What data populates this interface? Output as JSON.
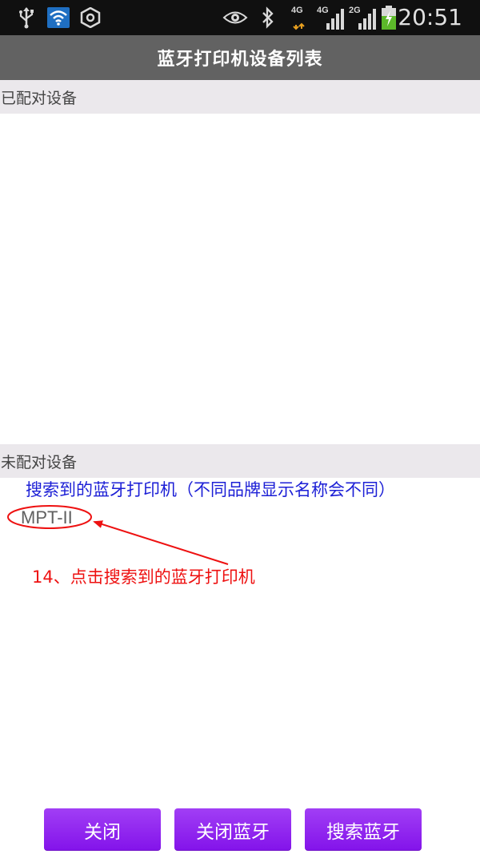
{
  "status_bar": {
    "time": "20:51",
    "icons": [
      "usb-icon",
      "wifi-icon",
      "settings-hexagon-icon",
      "eye-icon",
      "bluetooth-icon",
      "signal-4g-icon",
      "signal-4g-icon",
      "signal-2g-icon",
      "battery-charging-icon"
    ],
    "network_tags": [
      "4G",
      "4G",
      "2G"
    ]
  },
  "title_bar": {
    "title": "蓝牙打印机设备列表"
  },
  "paired_section": {
    "label": "已配对设备",
    "devices": []
  },
  "unpaired_section": {
    "label": "未配对设备",
    "devices": [
      {
        "name": "MPT-II"
      }
    ]
  },
  "annotations": {
    "blue_note": "搜索到的蓝牙打印机（不同品牌显示名称会不同）",
    "red_note": "14、点击搜索到的蓝牙打印机",
    "highlight_color": "#ee1111",
    "note_color": "#1c1fd6"
  },
  "buttons": {
    "close_label": "关闭",
    "close_bluetooth_label": "关闭蓝牙",
    "search_bluetooth_label": "搜索蓝牙"
  },
  "colors": {
    "button_purple": "#8f23ef",
    "title_bar_bg": "#626262",
    "section_bg": "#ebe8ec",
    "status_bar_bg": "#101010"
  }
}
